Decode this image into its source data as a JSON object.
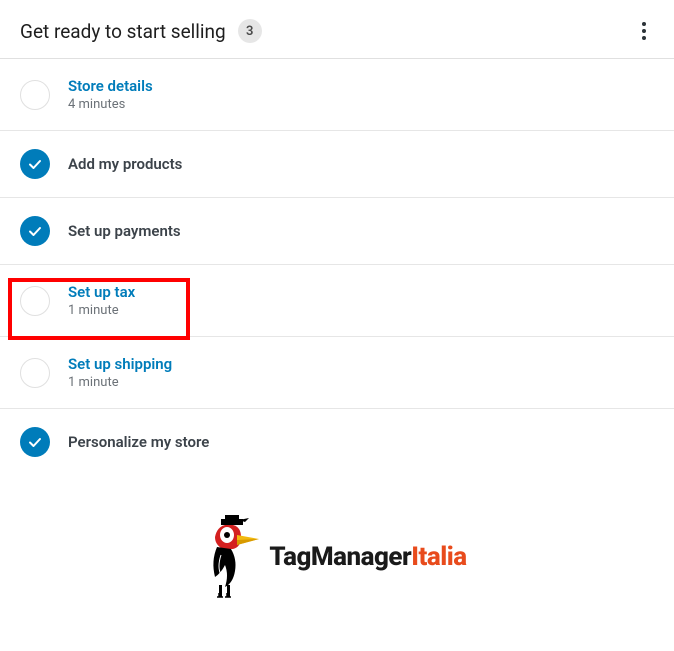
{
  "header": {
    "title": "Get ready to start selling",
    "badge": "3"
  },
  "tasks": [
    {
      "title": "Store details",
      "subtitle": "4 minutes",
      "done": false,
      "isLink": true
    },
    {
      "title": "Add my products",
      "subtitle": "",
      "done": true,
      "isLink": false
    },
    {
      "title": "Set up payments",
      "subtitle": "",
      "done": true,
      "isLink": false
    },
    {
      "title": "Set up tax",
      "subtitle": "1 minute",
      "done": false,
      "isLink": true,
      "highlighted": true
    },
    {
      "title": "Set up shipping",
      "subtitle": "1 minute",
      "done": false,
      "isLink": true
    },
    {
      "title": "Personalize my store",
      "subtitle": "",
      "done": true,
      "isLink": false
    }
  ],
  "brand": {
    "part1": "TagManager",
    "part2": "Italia"
  }
}
